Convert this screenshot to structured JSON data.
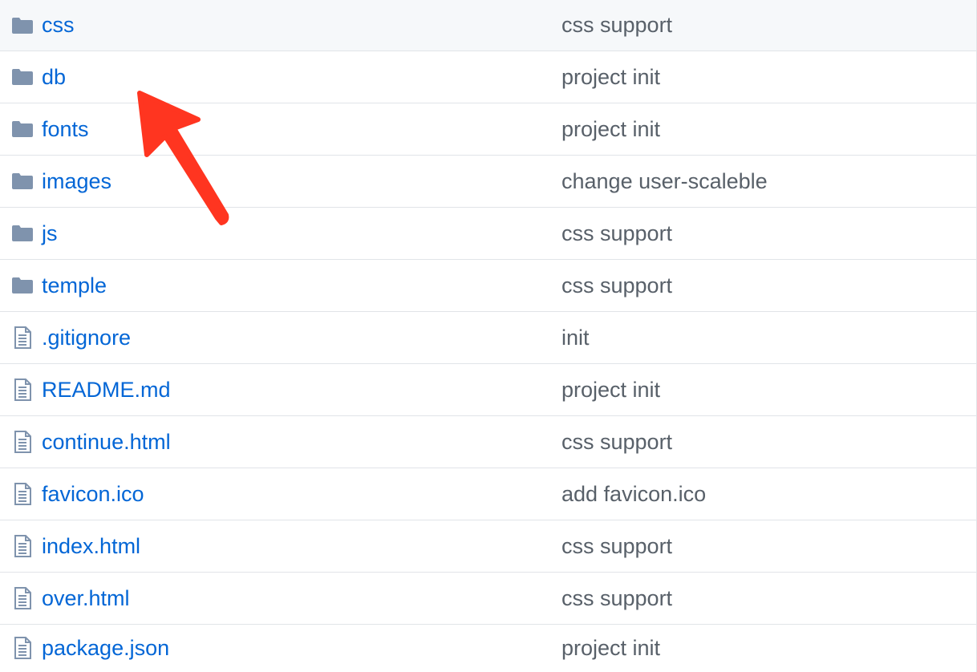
{
  "files": [
    {
      "name": "css",
      "type": "folder",
      "icon": "folder-icon",
      "message": "css support"
    },
    {
      "name": "db",
      "type": "folder",
      "icon": "folder-icon",
      "message": "project init"
    },
    {
      "name": "fonts",
      "type": "folder",
      "icon": "folder-icon",
      "message": "project init"
    },
    {
      "name": "images",
      "type": "folder",
      "icon": "folder-icon",
      "message": "change user-scaleble"
    },
    {
      "name": "js",
      "type": "folder",
      "icon": "folder-icon",
      "message": "css support"
    },
    {
      "name": "temple",
      "type": "folder",
      "icon": "folder-icon",
      "message": "css support"
    },
    {
      "name": ".gitignore",
      "type": "file",
      "icon": "file-icon",
      "message": "init"
    },
    {
      "name": "README.md",
      "type": "file",
      "icon": "file-icon",
      "message": "project init"
    },
    {
      "name": "continue.html",
      "type": "file",
      "icon": "file-icon",
      "message": "css support"
    },
    {
      "name": "favicon.ico",
      "type": "file",
      "icon": "file-icon",
      "message": "add favicon.ico"
    },
    {
      "name": "index.html",
      "type": "file",
      "icon": "file-icon",
      "message": "css support"
    },
    {
      "name": "over.html",
      "type": "file",
      "icon": "file-icon",
      "message": "css support"
    },
    {
      "name": "package.json",
      "type": "file",
      "icon": "file-icon",
      "message": "project init"
    }
  ],
  "colors": {
    "link": "#0366d6",
    "message": "#586069",
    "icon": "#7f93ad",
    "border": "#e1e4e8",
    "header_bg": "#f6f8fa",
    "annotation_arrow": "#ff3520"
  },
  "annotation": {
    "icon": "red-arrow-icon",
    "points_to": "db"
  }
}
